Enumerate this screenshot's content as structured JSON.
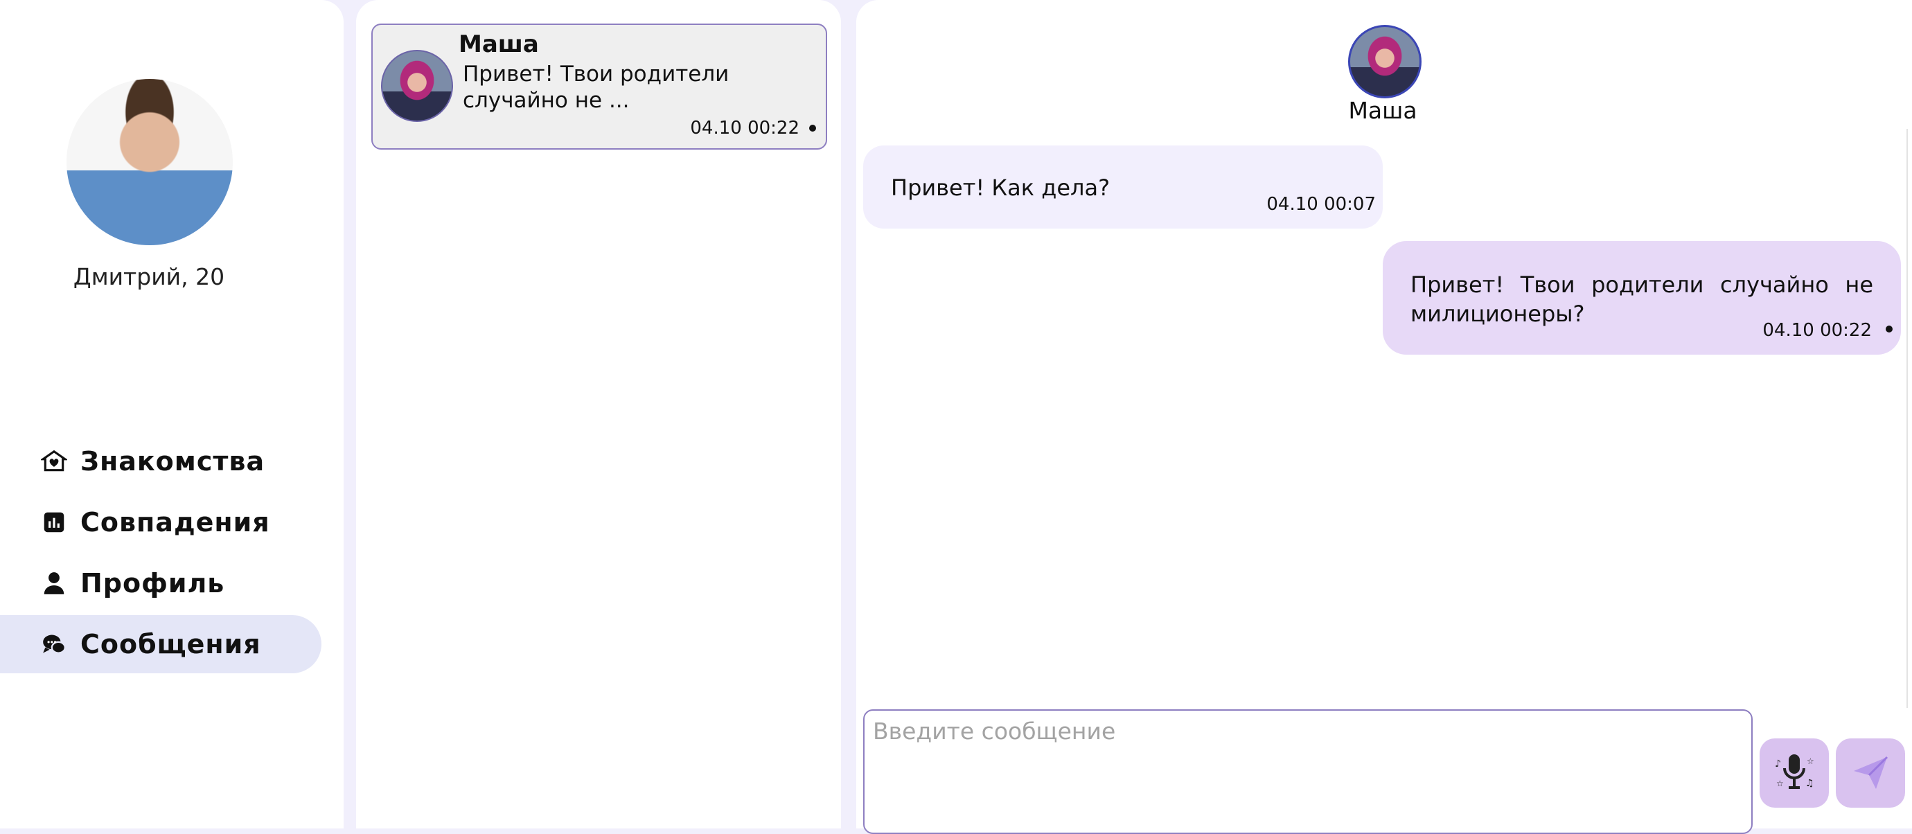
{
  "sidebar": {
    "user_name": "Дмитрий, 20",
    "nav": [
      {
        "label": "Знакомства",
        "icon": "home-heart-icon",
        "active": false
      },
      {
        "label": "Совпадения",
        "icon": "chart-icon",
        "active": false
      },
      {
        "label": "Профиль",
        "icon": "user-icon",
        "active": false
      },
      {
        "label": "Сообщения",
        "icon": "chat-icon",
        "active": true
      }
    ]
  },
  "chat_list": {
    "items": [
      {
        "name": "Маша",
        "preview": "Привет! Твои родители случайно не ...",
        "time": "04.10 00:22",
        "unread": true
      }
    ]
  },
  "conversation": {
    "partner_name": "Маша",
    "messages": [
      {
        "direction": "incoming",
        "text": "Привет! Как дела?",
        "time": "04.10 00:07"
      },
      {
        "direction": "outgoing",
        "text": "Привет! Твои родители случайно не милиционеры?",
        "time": "04.10 00:22",
        "unread": true
      }
    ],
    "composer": {
      "placeholder": "Введите сообщение",
      "value": ""
    },
    "buttons": {
      "mic_icon": "microphone-icon",
      "send_icon": "send-icon"
    }
  },
  "colors": {
    "background": "#f1effc",
    "active_nav": "#e4e6f7",
    "incoming_bubble": "#f2effd",
    "outgoing_bubble": "#e7d9f7",
    "accent_border": "#8e7fc1",
    "button": "#d9c2ef"
  }
}
